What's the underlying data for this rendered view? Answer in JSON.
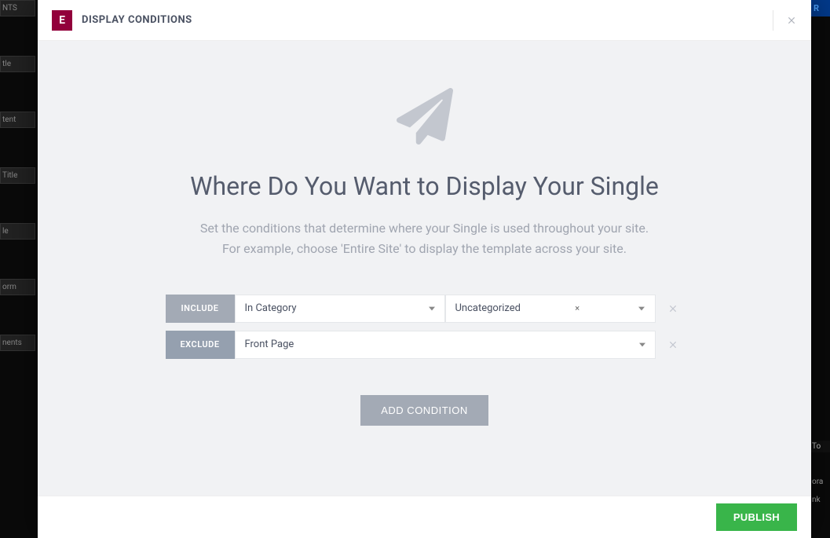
{
  "header": {
    "logo_letter": "E",
    "title": "DISPLAY CONDITIONS"
  },
  "hero": {
    "heading": "Where Do You Want to Display Your Single",
    "subheading": "Set the conditions that determine where your Single is used throughout your site.\nFor example, choose 'Entire Site' to display the template across your site."
  },
  "conditions": {
    "rows": [
      {
        "badge": "INCLUDE",
        "badge_class": "include",
        "select1": "In Category",
        "select2": "Uncategorized",
        "has_second": true
      },
      {
        "badge": "EXCLUDE",
        "badge_class": "exclude",
        "select1": "Front Page",
        "select2": "",
        "has_second": false
      }
    ],
    "add_label": "ADD CONDITION"
  },
  "footer": {
    "publish_label": "PUBLISH"
  },
  "background": {
    "sidebar_items": [
      "NTS",
      "tle",
      "tent",
      "Title",
      "le",
      "orm",
      "nents"
    ],
    "right_top": "R",
    "right_items": [
      "To",
      "ora",
      "nk"
    ]
  }
}
